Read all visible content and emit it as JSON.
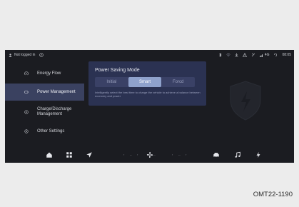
{
  "status": {
    "login_text": "Not logged in",
    "signal_text": "4G",
    "time": "08:05"
  },
  "sidebar": {
    "items": [
      {
        "label": "Energy Flow",
        "icon": "energy-flow-icon"
      },
      {
        "label": "Power Management",
        "icon": "power-management-icon",
        "active": true
      },
      {
        "label": "Charge/Discharge Management",
        "icon": "charge-discharge-icon"
      },
      {
        "label": "Other Settings",
        "icon": "settings-icon"
      }
    ]
  },
  "panel": {
    "title": "Power Saving Mode",
    "options": [
      "Initial",
      "Smart",
      "Forcd"
    ],
    "selected": "Smart",
    "description": "Intelligently select the best time to charge the vehicle to achieve a balance between economy and power"
  },
  "bottom_bar": {
    "fan_text": "--",
    "left_temp_text": "--",
    "right_temp_text": "--"
  },
  "caption": "OMT22-1190",
  "colors": {
    "screen_bg": "#1b1c21",
    "panel_bg": "#2b3252",
    "active_option": "#8fa2cc",
    "sidebar_active": "#3a4160"
  }
}
